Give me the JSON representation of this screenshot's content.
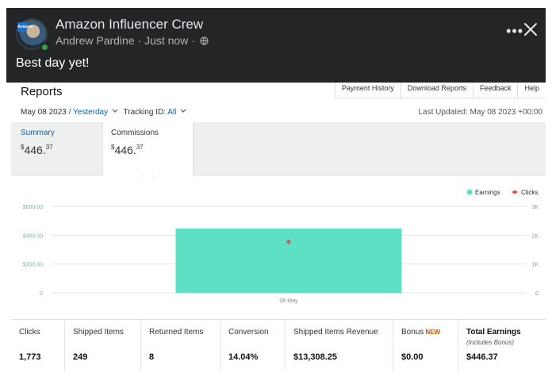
{
  "post": {
    "group_name": "Amazon Influencer Crew",
    "author": "Andrew Pardine",
    "time": "Just now",
    "separator": "·",
    "text": "Best day yet!",
    "avatar_badge": "Amazon",
    "icons": [
      "more-icon",
      "close-icon",
      "globe-icon"
    ]
  },
  "reports": {
    "title": "Reports",
    "links": [
      "Payment History",
      "Download Reports",
      "Feedback",
      "Help"
    ],
    "date": "May 08 2023",
    "date_sep": "/",
    "range": "Yesterday",
    "tracking_label": "Tracking ID:",
    "tracking_value": "All",
    "last_updated": "Last Updated: May 08 2023 +00:00",
    "tabs": [
      {
        "label": "Summary",
        "dollar": "$",
        "whole": "446",
        "cents": "37"
      },
      {
        "label": "Commissions",
        "dollar": "$",
        "whole": "446",
        "cents": "37"
      }
    ]
  },
  "chart_data": {
    "type": "bar",
    "categories": [
      "08 May"
    ],
    "series": [
      {
        "name": "Earnings",
        "values": [
          446.37
        ],
        "axis": "left",
        "color": "#5ee0c5"
      },
      {
        "name": "Clicks",
        "values": [
          1773
        ],
        "axis": "right",
        "color": "#d9534f",
        "mark": "point"
      }
    ],
    "y_ticks": [
      "0",
      "$200.00",
      "$400.00",
      "$600.00"
    ],
    "y_right_ticks": [
      "0",
      "1K",
      "2K",
      "3K"
    ],
    "ylim": [
      0,
      600
    ],
    "ylim_right": [
      0,
      3000
    ],
    "grid": true,
    "legend": "top-right"
  },
  "stats": [
    {
      "label": "Clicks",
      "value": "1,773"
    },
    {
      "label": "Shipped Items",
      "value": "249"
    },
    {
      "label": "Returned Items",
      "value": "8"
    },
    {
      "label": "Conversion",
      "value": "14.04%"
    },
    {
      "label": "Shipped Items Revenue",
      "value": "$13,308.25"
    },
    {
      "label": "Bonus",
      "badge": "NEW",
      "value": "$0.00"
    },
    {
      "label": "Total Earnings",
      "sublabel": "(Includes Bonus)",
      "value": "$446.37"
    }
  ],
  "colors": {
    "post_bg": "#242526",
    "link": "#0066c0",
    "earnings": "#5ee0c5",
    "clicks": "#d9534f",
    "tick_text": "#77b5b0"
  }
}
